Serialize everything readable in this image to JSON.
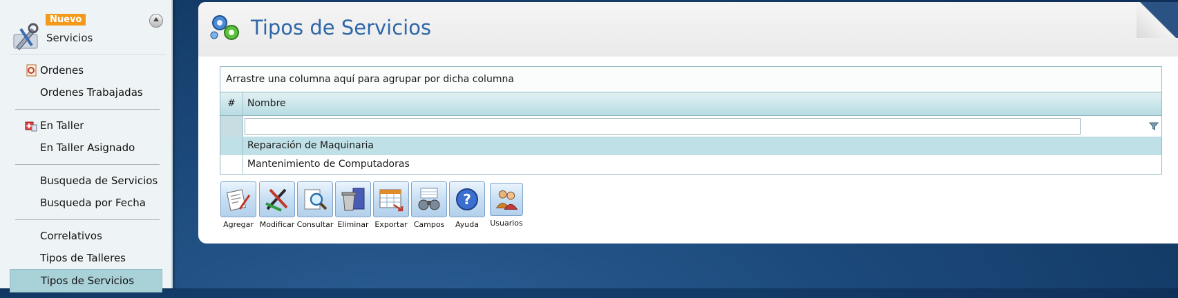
{
  "sidebar": {
    "badge": "Nuevo",
    "title": "Servicios",
    "groups": [
      {
        "items": [
          {
            "label": "Ordenes",
            "icon": "orders-icon"
          },
          {
            "label": "Ordenes Trabajadas",
            "icon": ""
          }
        ]
      },
      {
        "items": [
          {
            "label": "En Taller",
            "icon": "workshop-icon"
          },
          {
            "label": "En Taller Asignado",
            "icon": ""
          }
        ]
      },
      {
        "items": [
          {
            "label": "Busqueda de Servicios",
            "icon": ""
          },
          {
            "label": "Busqueda por Fecha",
            "icon": ""
          }
        ]
      },
      {
        "items": [
          {
            "label": "Correlativos",
            "icon": ""
          },
          {
            "label": "Tipos de Talleres",
            "icon": ""
          },
          {
            "label": "Tipos de Servicios",
            "icon": "",
            "active": true
          }
        ]
      }
    ]
  },
  "main": {
    "title": "Tipos de Servicios",
    "grid": {
      "group_hint": "Arrastre una columna aquí para agrupar por dicha columna",
      "columns": [
        "#",
        "Nombre"
      ],
      "filter_value": "",
      "rows": [
        {
          "num": "",
          "nombre": "Reparación de Maquinaria"
        },
        {
          "num": "",
          "nombre": "Mantenimiento de Computadoras"
        }
      ]
    },
    "toolbar": [
      {
        "label": "Agregar",
        "icon": "add-document-icon"
      },
      {
        "label": "Modificar",
        "icon": "edit-pencils-icon"
      },
      {
        "label": "Consultar",
        "icon": "search-magnifier-icon"
      },
      {
        "label": "Eliminar",
        "icon": "trash-can-icon"
      },
      {
        "label": "Exportar",
        "icon": "export-spreadsheet-icon"
      },
      {
        "label": "Campos",
        "icon": "binoculars-icon"
      },
      {
        "label": "Ayuda",
        "icon": "help-icon"
      },
      {
        "label": "Usuarios",
        "icon": "users-icon"
      }
    ]
  },
  "colors": {
    "accent_title": "#2e67a8",
    "badge": "#f39a1a",
    "active_item": "#a9d1d8",
    "grid_header": "#b7dce2",
    "row_alt": "#bfe0e6"
  }
}
